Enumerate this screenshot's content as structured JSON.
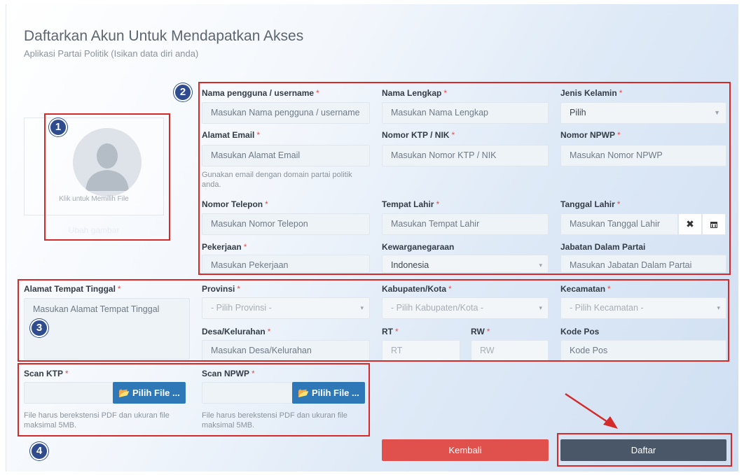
{
  "header": {
    "title": "Daftarkan Akun Untuk Mendapatkan Akses",
    "subtitle": "Aplikasi Partai Politik (Isikan data diri anda)"
  },
  "avatar": {
    "hint": "Klik untuk Memilih File",
    "change_label": "Ubah gambar"
  },
  "required_mark": "*",
  "badges": [
    "1",
    "2",
    "3",
    "4"
  ],
  "fields": {
    "username": {
      "label": "Nama pengguna / username",
      "placeholder": "Masukan Nama pengguna / username"
    },
    "fullname": {
      "label": "Nama Lengkap",
      "placeholder": "Masukan Nama Lengkap"
    },
    "gender": {
      "label": "Jenis Kelamin",
      "value": "Pilih"
    },
    "email": {
      "label": "Alamat Email",
      "placeholder": "Masukan Alamat Email",
      "help": "Gunakan email dengan domain partai politik anda."
    },
    "ktp": {
      "label": "Nomor KTP / NIK",
      "placeholder": "Masukan Nomor KTP / NIK"
    },
    "npwp": {
      "label": "Nomor NPWP",
      "placeholder": "Masukan Nomor NPWP"
    },
    "phone": {
      "label": "Nomor Telepon",
      "placeholder": "Masukan Nomor Telepon"
    },
    "birthplace": {
      "label": "Tempat Lahir",
      "placeholder": "Masukan Tempat Lahir"
    },
    "birthdate": {
      "label": "Tanggal Lahir",
      "placeholder": "Masukan Tanggal Lahir"
    },
    "job": {
      "label": "Pekerjaan",
      "placeholder": "Masukan Pekerjaan"
    },
    "citizenship": {
      "label": "Kewarganegaraan",
      "value": "Indonesia"
    },
    "position": {
      "label": "Jabatan Dalam Partai",
      "placeholder": "Masukan Jabatan Dalam Partai"
    },
    "address": {
      "label": "Alamat Tempat Tinggal",
      "placeholder": "Masukan Alamat Tempat Tinggal"
    },
    "province": {
      "label": "Provinsi",
      "value": "- Pilih Provinsi -"
    },
    "regency": {
      "label": "Kabupaten/Kota",
      "value": "- Pilih Kabupaten/Kota -"
    },
    "district": {
      "label": "Kecamatan",
      "value": "- Pilih Kecamatan -"
    },
    "village": {
      "label": "Desa/Kelurahan",
      "placeholder": "Masukan Desa/Kelurahan"
    },
    "rt": {
      "label": "RT",
      "placeholder": "RT"
    },
    "rw": {
      "label": "RW",
      "placeholder": "RW"
    },
    "postal": {
      "label": "Kode Pos",
      "placeholder": "Kode Pos"
    },
    "scan_ktp": {
      "label": "Scan KTP",
      "button": "Pilih File ...",
      "help": "File harus berekstensi PDF dan ukuran file maksimal 5MB."
    },
    "scan_npwp": {
      "label": "Scan NPWP",
      "button": "Pilih File ...",
      "help": "File harus berekstensi PDF dan ukuran file maksimal 5MB."
    }
  },
  "actions": {
    "back_label": "Kembali",
    "submit_label": "Daftar",
    "back_color": "#e0514d",
    "submit_color": "#4a5768"
  },
  "annotation_color": "#d42a2a",
  "badge_color": "#2f4c8f",
  "icons": {
    "clear": "close-icon",
    "calendar": "calendar-icon",
    "folder": "folder-icon",
    "dropdown": "caret-down-icon"
  }
}
